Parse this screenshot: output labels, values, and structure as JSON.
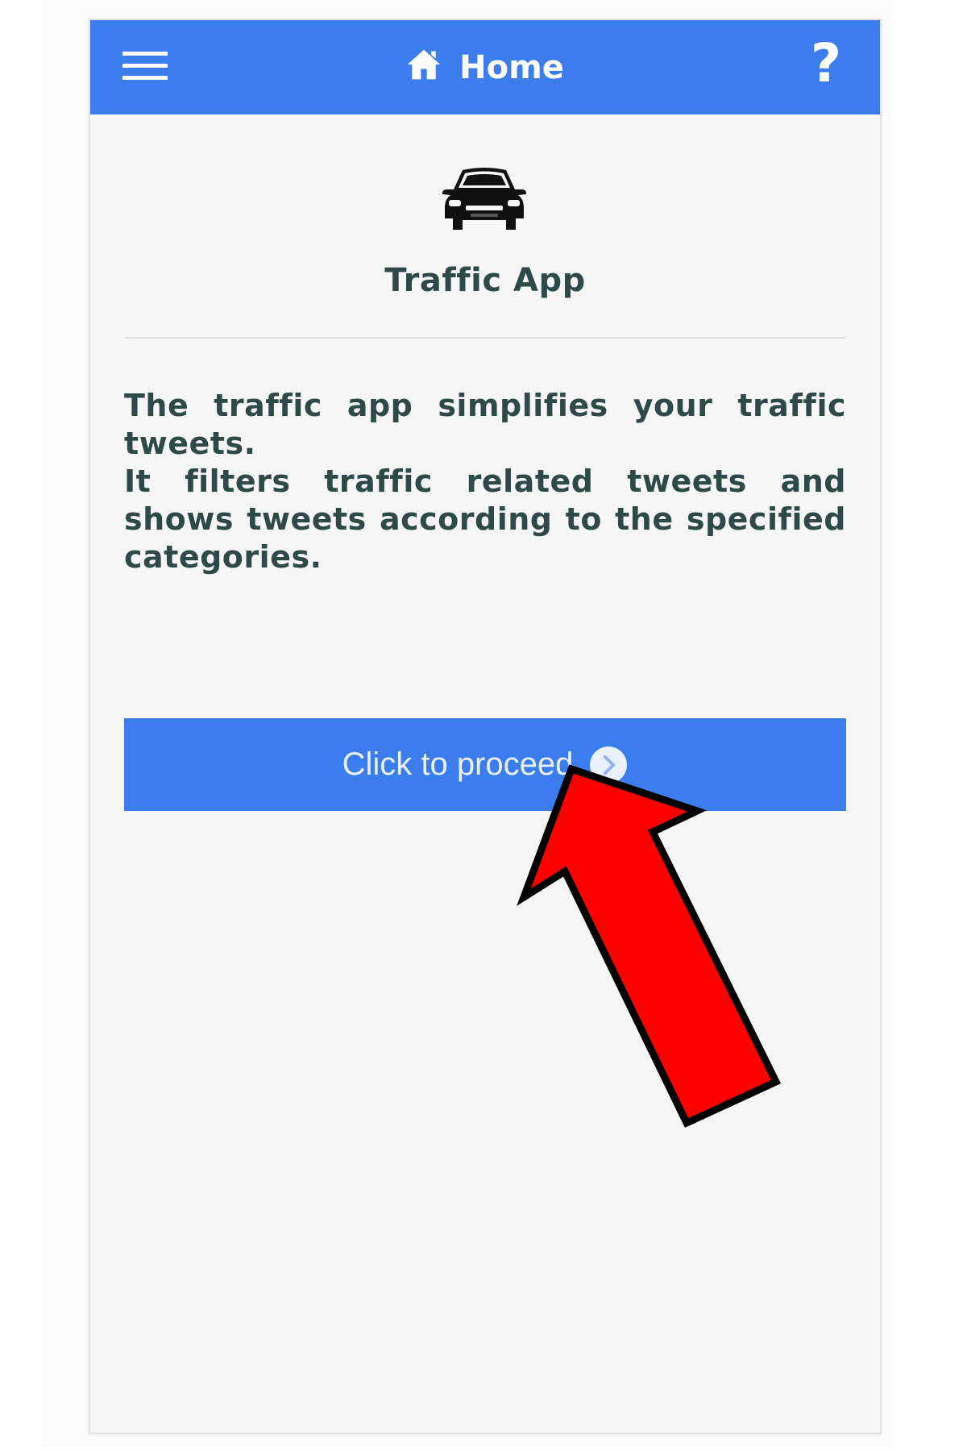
{
  "header": {
    "title": "Home",
    "help_label": "?",
    "color": "#3b7ded",
    "menu_icon": "hamburger-menu-icon",
    "home_icon": "home-icon"
  },
  "main": {
    "app_icon": "car-icon",
    "app_title": "Traffic App",
    "description": [
      "The traffic app simplifies your traffic tweets.",
      "It filters traffic related tweets and shows tweets according to the specified categories."
    ],
    "proceed_button": {
      "label": "Click to proceed",
      "icon": "chevron-right-circle-icon"
    }
  },
  "annotation": {
    "type": "arrow",
    "color": "#ff0000",
    "points_to": "proceed_button"
  }
}
